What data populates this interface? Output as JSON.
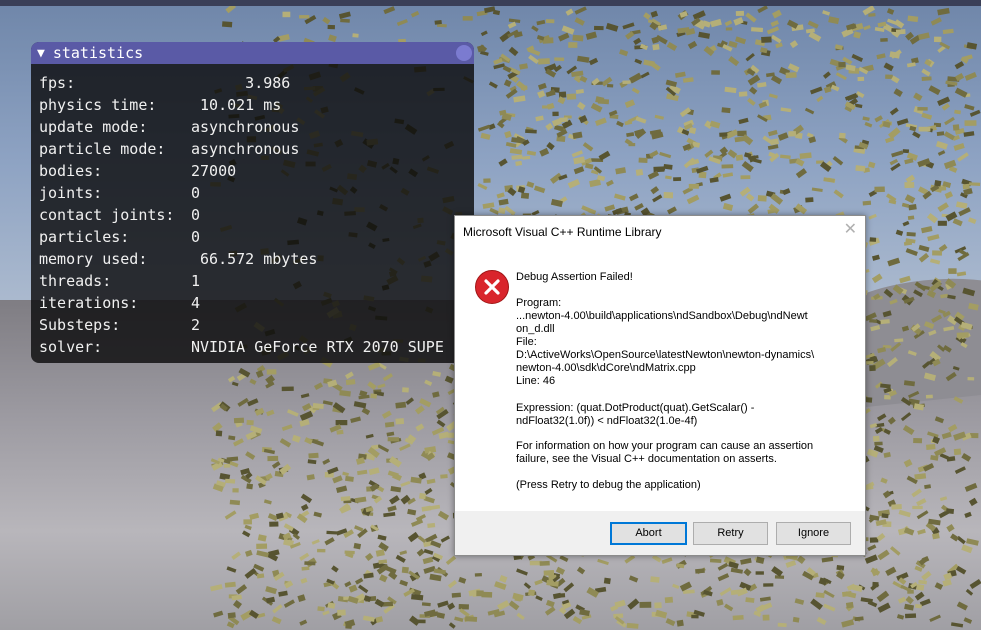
{
  "stats_panel": {
    "title": "statistics",
    "rows": [
      {
        "label": "fps:",
        "value": "      3.986"
      },
      {
        "label": "physics time:",
        "value": " 10.021 ms"
      },
      {
        "label": "update mode:",
        "value": "asynchronous"
      },
      {
        "label": "particle mode:",
        "value": "asynchronous"
      },
      {
        "label": "bodies:",
        "value": "27000"
      },
      {
        "label": "joints:",
        "value": "0"
      },
      {
        "label": "contact joints:",
        "value": "0"
      },
      {
        "label": "particles:",
        "value": "0"
      },
      {
        "label": "memory used:",
        "value": " 66.572 mbytes"
      },
      {
        "label": "threads:",
        "value": "1"
      },
      {
        "label": "iterations:",
        "value": "4"
      },
      {
        "label": "Substeps:",
        "value": "2"
      },
      {
        "label": "solver:",
        "value": "NVIDIA GeForce RTX 2070 SUPE"
      }
    ]
  },
  "dialog": {
    "title": "Microsoft Visual C++ Runtime Library",
    "close_label": "✕",
    "icon": "error-icon",
    "heading": "Debug Assertion Failed!",
    "program_label": "Program:",
    "program_path": "...newton-4.00\\build\\applications\\ndSandbox\\Debug\\ndNewt\non_d.dll",
    "file_label": "File:",
    "file_path": "D:\\ActiveWorks\\OpenSource\\latestNewton\\newton-dynamics\\\nnewton-4.00\\sdk\\dCore\\ndMatrix.cpp",
    "line": "Line: 46",
    "expression": "Expression: (quat.DotProduct(quat).GetScalar() -\nndFloat32(1.0f)) < ndFloat32(1.0e-4f)",
    "info": "For information on how your program can cause an assertion\nfailure, see the Visual C++ documentation on asserts.",
    "retry_hint": "(Press Retry to debug the application)",
    "buttons": {
      "abort": "Abort",
      "retry": "Retry",
      "ignore": "Ignore"
    }
  },
  "colors": {
    "panel_title_bar": "#5a5aa6",
    "dialog_default_border": "#0078d7",
    "error_red": "#d9252c",
    "box_olive": "#8f8a55"
  }
}
